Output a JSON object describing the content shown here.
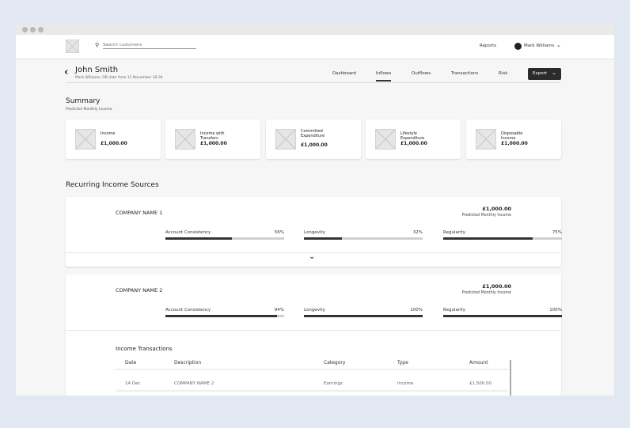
{
  "header": {
    "search_placeholder": "Search customers",
    "reports": "Reports",
    "user": "Mark Williams"
  },
  "customer": {
    "name": "John Smith",
    "subtitle": "Mark Williams, OB date from 11 November 10:34"
  },
  "tabs": [
    "Dashboard",
    "Inflows",
    "Outflows",
    "Transactions",
    "Risk"
  ],
  "active_tab": "Inflows",
  "export_label": "Export",
  "summary": {
    "title": "Summary",
    "subtitle": "Predicted Monthly Income",
    "cards": [
      {
        "label": "Income",
        "value": "£1,000.00"
      },
      {
        "label": "Income with Transfers",
        "value": "£1,000.00"
      },
      {
        "label": "Committed Expenditure",
        "value": "£1,000.00"
      },
      {
        "label": "Lifestyle Expenditure",
        "value": "£1,000.00"
      },
      {
        "label": "Disposable Income",
        "value": "£1,000.00"
      }
    ]
  },
  "recurring": {
    "title": "Recurring Income Sources",
    "sources": [
      {
        "name": "COMPANY NAME 1",
        "amount": "£1,000.00",
        "amount_label": "Predicted Monthly Income",
        "metrics": [
          {
            "label": "Account Consistency",
            "value": "56%",
            "pct": 56
          },
          {
            "label": "Longevity",
            "value": "32%",
            "pct": 32
          },
          {
            "label": "Regularity",
            "value": "75%",
            "pct": 75
          }
        ]
      },
      {
        "name": "COMPANY NAME 2",
        "amount": "£1,000.00",
        "amount_label": "Predicted Monthly Income",
        "metrics": [
          {
            "label": "Account Consistency",
            "value": "94%",
            "pct": 94
          },
          {
            "label": "Longevity",
            "value": "100%",
            "pct": 100
          },
          {
            "label": "Regularity",
            "value": "100%",
            "pct": 100
          }
        ]
      }
    ]
  },
  "transactions": {
    "title": "Income Transactions",
    "columns": [
      "Date",
      "Description",
      "Category",
      "Type",
      "Amount"
    ],
    "rows": [
      {
        "date": "14 Dec",
        "description": "COMPANY NAME 2",
        "category": "Earnings",
        "type": "Income",
        "amount": "£1,500.00"
      }
    ]
  }
}
